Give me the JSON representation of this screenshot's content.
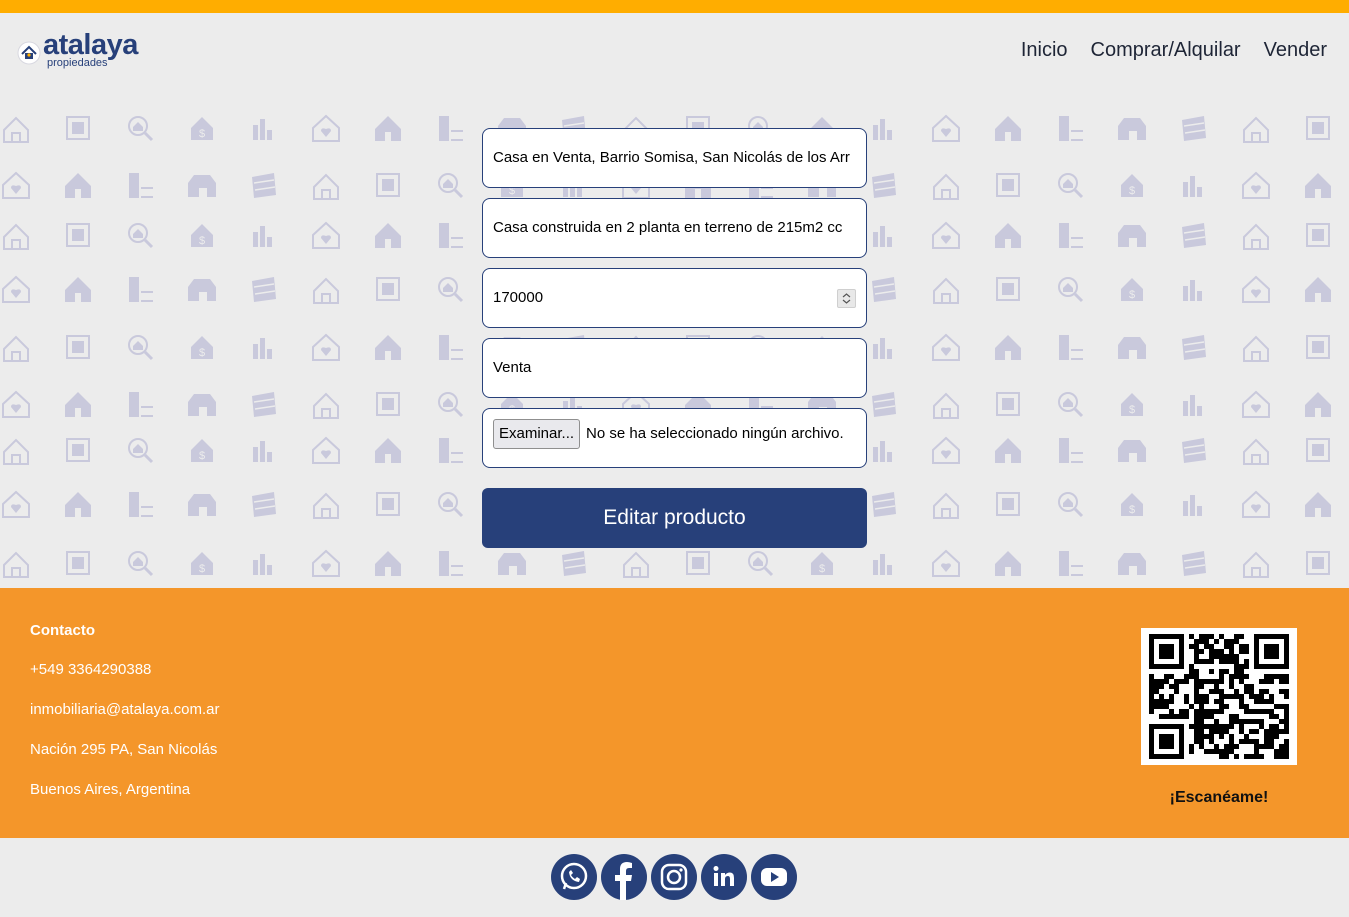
{
  "brand": {
    "name": "atalaya",
    "sub": "propiedades"
  },
  "nav": {
    "items": [
      "Inicio",
      "Comprar/Alquilar",
      "Vender"
    ]
  },
  "form": {
    "title_value": "Casa en Venta, Barrio Somisa, San Nicolás de los Arr",
    "description_value": "Casa construida en 2 planta en terreno de 215m2 cc",
    "price_value": "170000",
    "operation_value": "Venta",
    "file_button": "Examinar...",
    "file_status": "No se ha seleccionado ningún archivo.",
    "submit_label": "Editar producto"
  },
  "footer": {
    "contact_title": "Contacto",
    "phone": "+549 3364290388",
    "email": "inmobiliaria@atalaya.com.ar",
    "address": "Nación 295 PA, San Nicolás",
    "region": "Buenos Aires, Argentina",
    "scan_label": "¡Escanéame!"
  },
  "social": [
    "whatsapp-icon",
    "facebook-icon",
    "instagram-icon",
    "linkedin-icon",
    "youtube-icon"
  ],
  "colors": {
    "accent": "#ffad00",
    "footer": "#f4962a",
    "primary": "#27407a",
    "background": "#ececec"
  }
}
